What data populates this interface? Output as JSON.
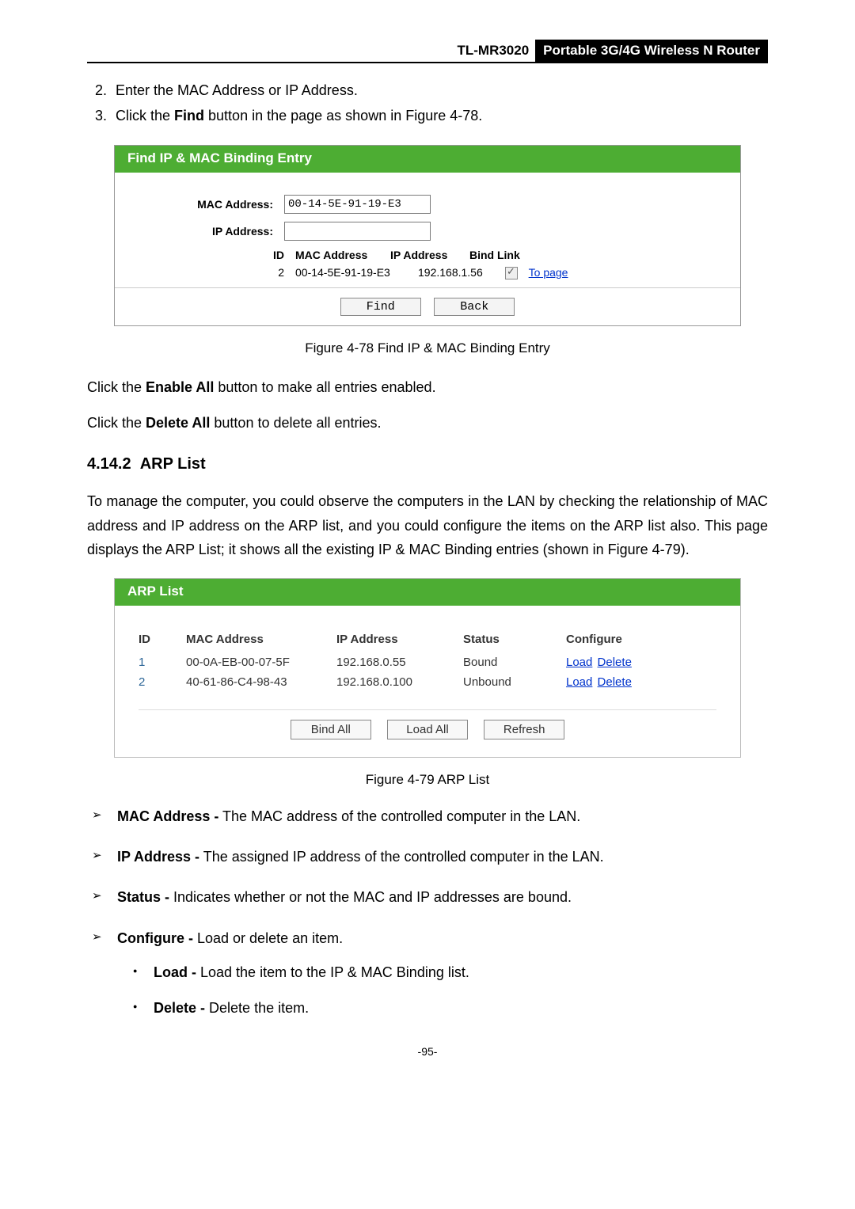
{
  "header": {
    "model": "TL-MR3020",
    "description": "Portable 3G/4G Wireless N Router"
  },
  "steps": {
    "two": "Enter the MAC Address or IP Address.",
    "three_prefix": "Click the ",
    "three_bold": "Find",
    "three_suffix": " button in the page as shown in Figure 4-78."
  },
  "figure478": {
    "title": "Find IP & MAC Binding Entry",
    "labels": {
      "mac": "MAC Address:",
      "ip": "IP Address:",
      "id": "ID",
      "mac_col": "MAC Address",
      "ip_col": "IP Address",
      "bind_col": "Bind Link"
    },
    "inputs": {
      "mac_value": "00-14-5E-91-19-E3",
      "ip_value": ""
    },
    "row": {
      "id": "2",
      "mac": "00-14-5E-91-19-E3",
      "ip": "192.168.1.56",
      "link": "To page"
    },
    "buttons": {
      "find": "Find",
      "back": "Back"
    },
    "caption": "Figure 4-78    Find IP & MAC Binding Entry"
  },
  "paragraphs": {
    "enable_prefix": "Click the ",
    "enable_bold": "Enable All",
    "enable_suffix": " button to make all entries enabled.",
    "delete_prefix": "Click the ",
    "delete_bold": "Delete All",
    "delete_suffix": " button to delete all entries."
  },
  "section": {
    "number": "4.14.2",
    "title": "ARP List",
    "body": "To manage the computer, you could observe the computers in the LAN by checking the relationship of MAC address and IP address on the ARP list, and you could configure the items on the ARP list also. This page displays the ARP List; it shows all the existing IP & MAC Binding entries (shown in Figure 4-79)."
  },
  "figure479": {
    "title": "ARP List",
    "headers": {
      "id": "ID",
      "mac": "MAC Address",
      "ip": "IP Address",
      "status": "Status",
      "config": "Configure"
    },
    "rows": [
      {
        "id": "1",
        "mac": "00-0A-EB-00-07-5F",
        "ip": "192.168.0.55",
        "status": "Bound",
        "load": "Load",
        "delete": "Delete"
      },
      {
        "id": "2",
        "mac": "40-61-86-C4-98-43",
        "ip": "192.168.0.100",
        "status": "Unbound",
        "load": "Load",
        "delete": "Delete"
      }
    ],
    "buttons": {
      "bindall": "Bind All",
      "loadall": "Load All",
      "refresh": "Refresh"
    },
    "caption": "Figure 4-79    ARP List"
  },
  "definitions": {
    "mac_term": "MAC Address -",
    "mac_def": " The MAC address of the controlled computer in the LAN.",
    "ip_term": "IP Address -",
    "ip_def": " The assigned IP address of the controlled computer in the LAN.",
    "status_term": "Status -",
    "status_def": " Indicates whether or not the MAC and IP addresses are bound.",
    "config_term": "Configure -",
    "config_def": " Load or delete an item.",
    "load_term": "Load -",
    "load_def": " Load the item to the IP & MAC Binding list.",
    "delete_term": "Delete -",
    "delete_def": " Delete the item."
  },
  "page_number": "-95-"
}
